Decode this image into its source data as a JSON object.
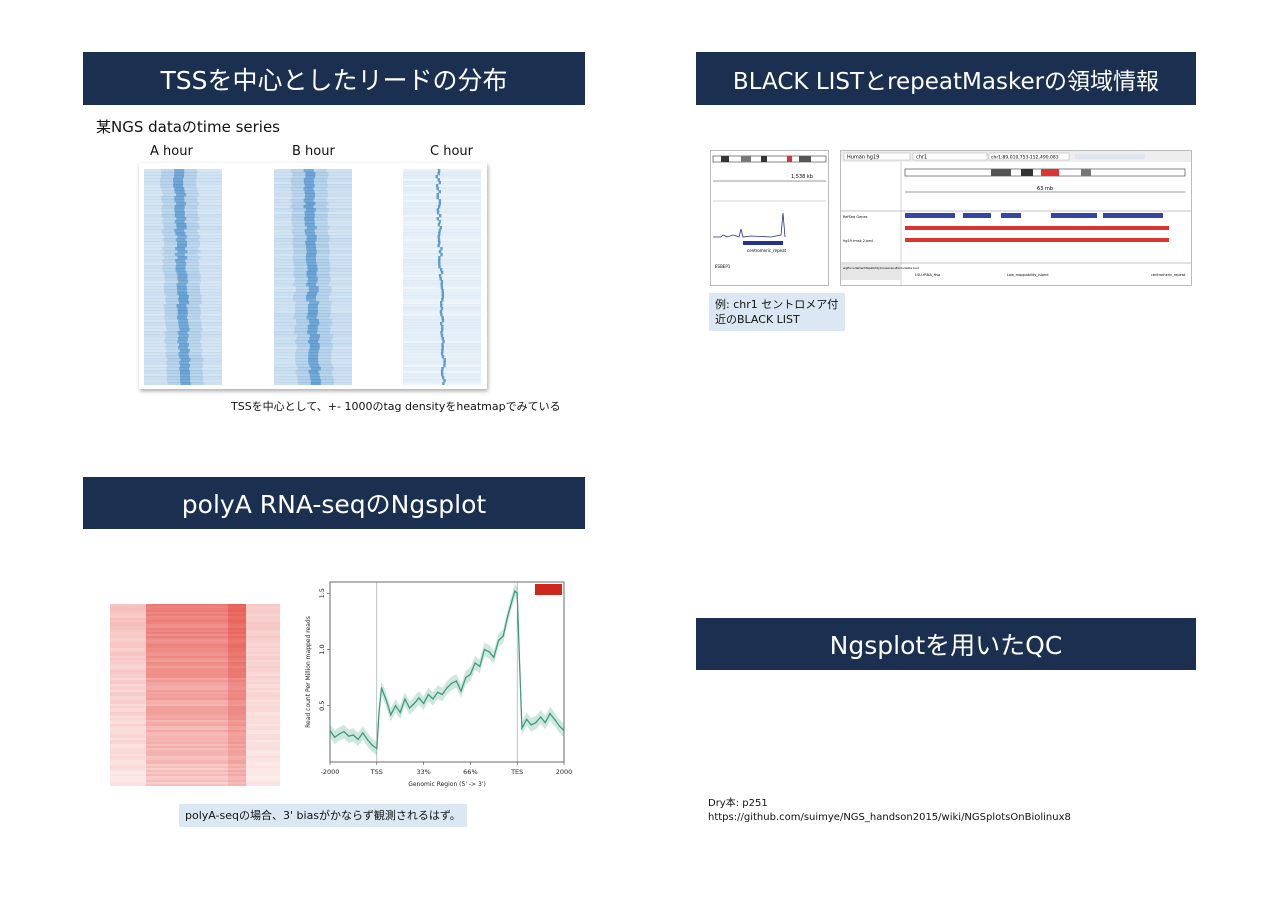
{
  "slides": {
    "tss": {
      "title": "TSSを中心としたリードの分布",
      "subtitle": "某NGS dataのtime series",
      "columns": [
        "A hour",
        "B hour",
        "C hour"
      ],
      "caption": "TSSを中心として、+- 1000のtag densityをheatmapでみている",
      "heatmap_color": "#2b7bc0"
    },
    "blacklist": {
      "title": "BLACK LISTとrepeatMaskerの領域情報",
      "note_line1": "例: chr1 セントロメア付",
      "note_line2": "近のBLACK LIST",
      "igv": {
        "genome": "Human hg19",
        "chrom": "chr1",
        "locus": "chr1:89,010,753-152,490,083",
        "span_left": "1,538 kb",
        "span_right": "63 mb",
        "tracks": [
          "RefSeq Genes",
          "hg19 rmsk 2.bed",
          "wgEncodeDacMapabilityConsensusExcludable.bed"
        ],
        "left_feature": "centromeric_repeat",
        "left_gene": "ESBEP1",
        "bl_labels": [
          "LSU-rRNA_Hsa",
          "Low_mappability_island",
          "centromeric_repeat"
        ]
      }
    },
    "polya": {
      "title": "polyA RNA-seqのNgsplot",
      "note": "polyA-seqの場合、3' biasがかならず観測されるはず。",
      "heatmap_color": "#e0291f",
      "line_color": "#3c9c7a"
    },
    "qc": {
      "title": "Ngsplotを用いたQC",
      "ref_line1": "Dry本: p251",
      "ref_line2": "https://github.com/suimye/NGS_handson2015/wiki/NGSplotsOnBiolinux8"
    }
  },
  "chart_data": {
    "type": "line",
    "xlabel": "Genomic Region (5' -> 3')",
    "ylabel": "Read count Per Million mapped reads",
    "x_ticks": [
      "-2000",
      "TSS",
      "33%",
      "66%",
      "TES",
      "2000"
    ],
    "y_ticks": [
      "0.5",
      "1.0",
      "1.5"
    ],
    "ylim": [
      0.0,
      1.6
    ],
    "legend_color": "#d0271c",
    "series": [
      {
        "x": [
          0,
          2,
          4,
          6,
          8,
          10,
          12,
          14,
          16,
          18,
          20,
          21,
          22,
          24,
          26,
          28,
          30,
          32,
          34,
          36,
          38,
          40,
          42,
          44,
          46,
          48,
          50,
          52,
          54,
          56,
          58,
          60,
          62,
          64,
          66,
          68,
          70,
          72,
          74,
          76,
          78,
          79,
          80,
          81,
          82,
          84,
          86,
          88,
          90,
          92,
          94,
          96,
          98,
          100
        ],
        "y": [
          0.28,
          0.22,
          0.25,
          0.27,
          0.23,
          0.24,
          0.2,
          0.26,
          0.2,
          0.15,
          0.12,
          0.45,
          0.66,
          0.55,
          0.42,
          0.5,
          0.44,
          0.56,
          0.48,
          0.52,
          0.57,
          0.52,
          0.6,
          0.56,
          0.62,
          0.6,
          0.66,
          0.7,
          0.72,
          0.63,
          0.75,
          0.78,
          0.88,
          0.85,
          1.0,
          0.98,
          0.93,
          1.08,
          1.12,
          1.3,
          1.45,
          1.52,
          1.5,
          0.9,
          0.3,
          0.38,
          0.33,
          0.35,
          0.4,
          0.35,
          0.43,
          0.38,
          0.32,
          0.28
        ]
      }
    ]
  }
}
